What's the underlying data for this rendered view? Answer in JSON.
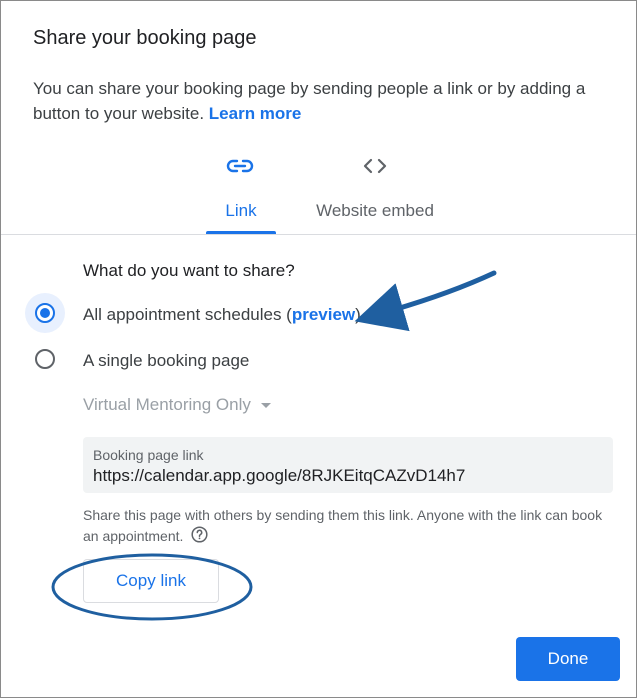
{
  "dialog": {
    "title": "Share your booking page",
    "description": "You can share your booking page by sending people a link or by adding a button to your website.",
    "learn_more": "Learn more"
  },
  "tabs": [
    {
      "label": "Link",
      "icon": "link-icon",
      "selected": true
    },
    {
      "label": "Website embed",
      "icon": "code-icon",
      "selected": false
    }
  ],
  "share": {
    "question": "What do you want to share?",
    "option_all_prefix": "All appointment schedules (",
    "option_all_link": "preview",
    "option_all_suffix": ")",
    "option_single": "A single booking page",
    "selected_option": "all",
    "dropdown_value": "Virtual Mentoring Only"
  },
  "link_field": {
    "label": "Booking page link",
    "value": "https://calendar.app.google/8RJKEitqCAZvD14h7"
  },
  "help_text": "Share this page with others by sending them this link. Anyone with the link can book an appointment.",
  "buttons": {
    "copy_link": "Copy link",
    "done": "Done"
  },
  "colors": {
    "accent": "#1a73e8",
    "annotation": "#1f5fa0"
  }
}
